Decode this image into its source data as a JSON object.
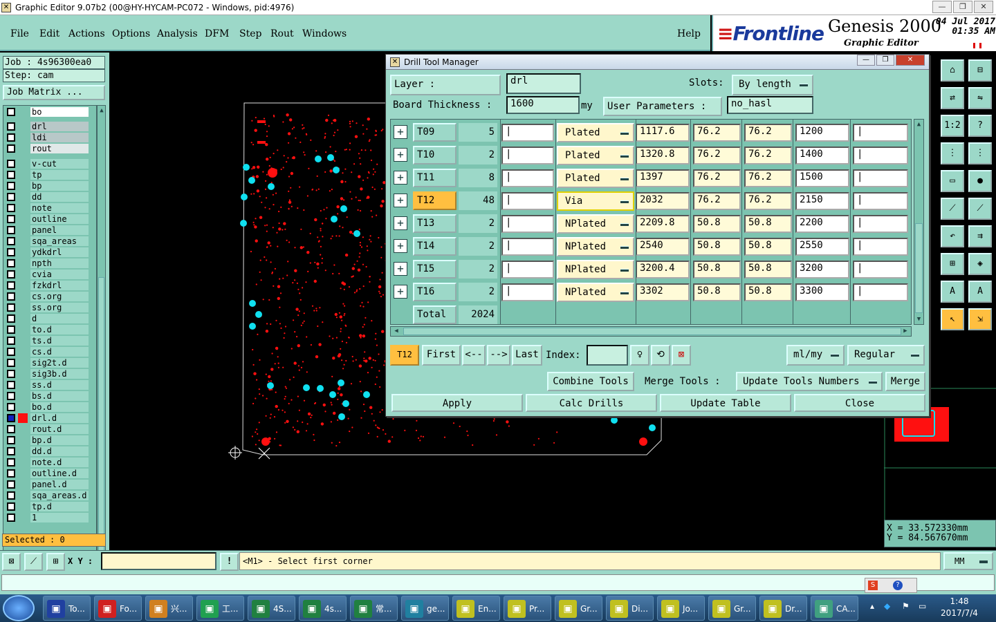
{
  "window": {
    "title": "Graphic Editor 9.07b2 (00@HY-HYCAM-PC072 - Windows, pid:4976)",
    "min": "—",
    "max": "❐",
    "close": "✕"
  },
  "menu": {
    "items": [
      "File",
      "Edit",
      "Actions",
      "Options",
      "Analysis",
      "DFM",
      "Step",
      "Rout",
      "Windows"
    ],
    "help": "Help"
  },
  "brand": {
    "company": "Frontline",
    "product": "Genesis 2000",
    "subtitle": "Graphic Editor",
    "date": "04 Jul 2017",
    "time": "01:35 AM"
  },
  "job": {
    "job_line": "Job : 4s96300ea0",
    "step_line": "Step: cam",
    "job_matrix": "Job Matrix ..."
  },
  "layers": [
    "bo",
    "drl",
    "ldi",
    "rout",
    "v-cut",
    "tp",
    "bp",
    "dd",
    "note",
    "outline",
    "panel",
    "sqa_areas",
    "ydkdrl",
    "npth",
    "cvia",
    "fzkdrl",
    "cs.org",
    "ss.org",
    "d",
    "to.d",
    "ts.d",
    "cs.d",
    "sig2t.d",
    "sig3b.d",
    "ss.d",
    "bs.d",
    "bo.d",
    "drl.d",
    "rout.d",
    "bp.d",
    "dd.d",
    "note.d",
    "outline.d",
    "panel.d",
    "sqa_areas.d",
    "tp.d",
    "1"
  ],
  "selected_text": "Selected : 0",
  "dialog": {
    "title": "Drill Tool Manager",
    "layer_label": "Layer          :",
    "layer_value": "drl",
    "slots_label": "Slots:",
    "slots_value": "By length",
    "board_thickness_label": "Board Thickness :",
    "board_thickness_value": "1600",
    "board_thickness_unit": "my",
    "user_params_label": "User Parameters :",
    "user_params_value": "no_hasl",
    "rows": [
      {
        "tool": "T09",
        "count": "5",
        "type": "Plated",
        "v1": "1117.6",
        "v2": "76.2",
        "v3": "76.2",
        "v4": "1200"
      },
      {
        "tool": "T10",
        "count": "2",
        "type": "Plated",
        "v1": "1320.8",
        "v2": "76.2",
        "v3": "76.2",
        "v4": "1400"
      },
      {
        "tool": "T11",
        "count": "8",
        "type": "Plated",
        "v1": "1397",
        "v2": "76.2",
        "v3": "76.2",
        "v4": "1500"
      },
      {
        "tool": "T12",
        "count": "48",
        "type": "Via",
        "v1": "2032",
        "v2": "76.2",
        "v3": "76.2",
        "v4": "2150"
      },
      {
        "tool": "T13",
        "count": "2",
        "type": "NPlated",
        "v1": "2209.8",
        "v2": "50.8",
        "v3": "50.8",
        "v4": "2200"
      },
      {
        "tool": "T14",
        "count": "2",
        "type": "NPlated",
        "v1": "2540",
        "v2": "50.8",
        "v3": "50.8",
        "v4": "2550"
      },
      {
        "tool": "T15",
        "count": "2",
        "type": "NPlated",
        "v1": "3200.4",
        "v2": "50.8",
        "v3": "50.8",
        "v4": "3200"
      },
      {
        "tool": "T16",
        "count": "2",
        "type": "NPlated",
        "v1": "3302",
        "v2": "50.8",
        "v3": "50.8",
        "v4": "3300"
      }
    ],
    "total_label": "Total",
    "total_value": "2024",
    "current_tool": "T12",
    "nav": {
      "first": "First",
      "prev": "<--",
      "next": "-->",
      "last": "Last",
      "index_label": "Index:",
      "units": "ml/my",
      "mode": "Regular"
    },
    "actions": {
      "combine": "Combine Tools",
      "merge_label": "Merge Tools :",
      "update_numbers": "Update Tools Numbers",
      "merge": "Merge"
    },
    "bottom": {
      "apply": "Apply",
      "calc": "Calc Drills",
      "update_table": "Update Table",
      "close": "Close"
    }
  },
  "coords": {
    "x": "X = 33.572330mm",
    "y": "Y = 84.567670mm"
  },
  "status": {
    "xy_label": "X Y :",
    "warn": "!",
    "message": "<M1> - Select first corner",
    "units": "MM"
  },
  "taskbar": {
    "items": [
      "To...",
      "Fo...",
      "兴...",
      "工...",
      "4S...",
      "4s...",
      "常...",
      "ge...",
      "En...",
      "Pr...",
      "Gr...",
      "Di...",
      "Jo...",
      "Gr...",
      "Dr...",
      "CA..."
    ],
    "time": "1:48",
    "date": "2017/7/4"
  },
  "colors": {
    "panel": "#9cd8c8",
    "highlight": "#ffbf40",
    "copper_red": "#ff1010",
    "drill_cyan": "#10e0f0"
  }
}
